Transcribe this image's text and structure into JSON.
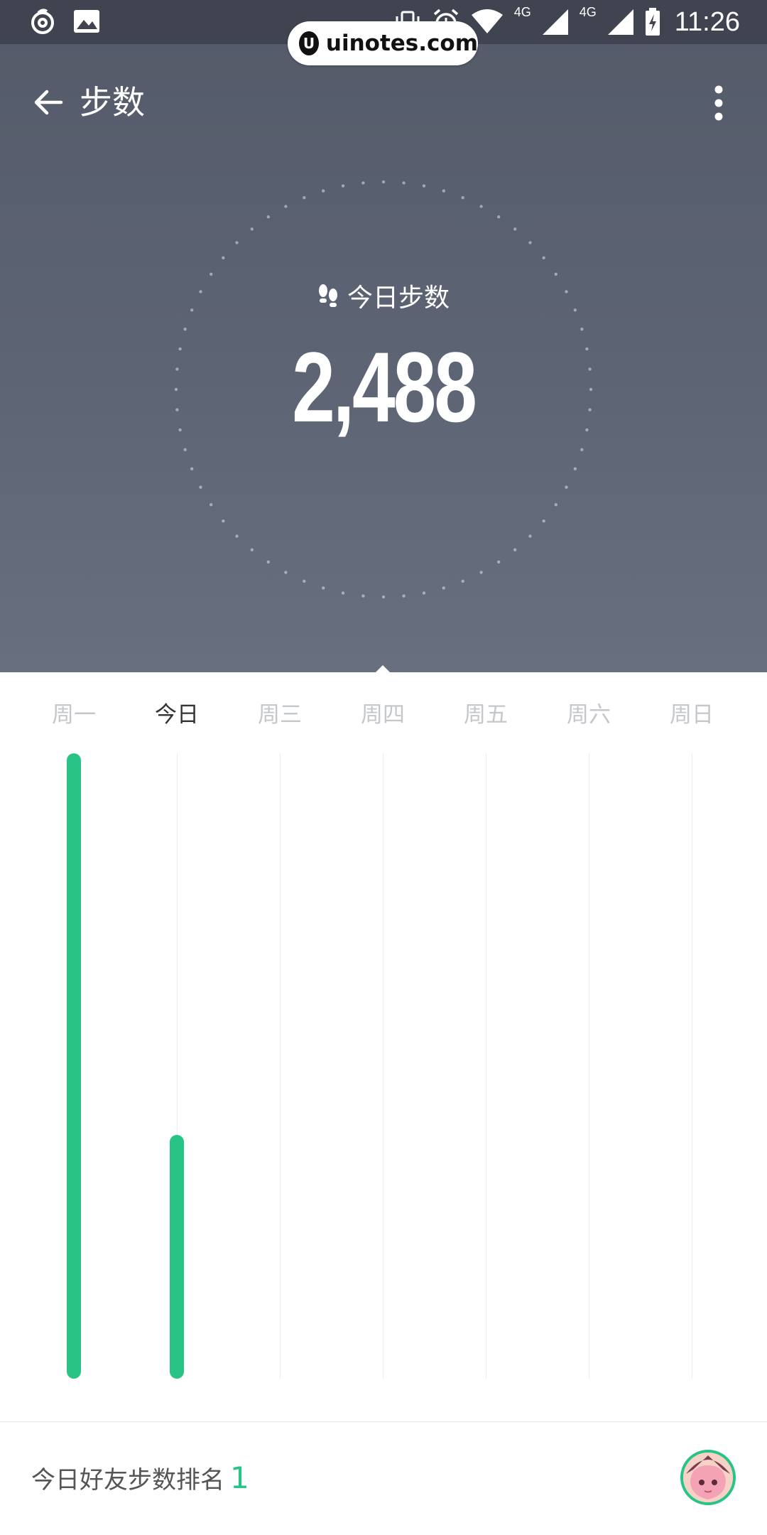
{
  "status_bar": {
    "time": "11:26",
    "network_1": "4G",
    "network_2": "4G"
  },
  "watermark": {
    "text": "uinotes.com"
  },
  "header": {
    "title": "步数"
  },
  "today": {
    "label": "今日步数",
    "steps": "2,488"
  },
  "days": [
    {
      "label": "周一",
      "active": false
    },
    {
      "label": "今日",
      "active": true
    },
    {
      "label": "周三",
      "active": false
    },
    {
      "label": "周四",
      "active": false
    },
    {
      "label": "周五",
      "active": false
    },
    {
      "label": "周六",
      "active": false
    },
    {
      "label": "周日",
      "active": false
    }
  ],
  "chart_data": {
    "type": "bar",
    "categories": [
      "周一",
      "今日",
      "周三",
      "周四",
      "周五",
      "周六",
      "周日"
    ],
    "values": [
      1.0,
      0.39,
      0,
      0,
      0,
      0,
      0
    ],
    "ylim": [
      0,
      1
    ]
  },
  "ranking": {
    "label": "今日好友步数排名",
    "rank": "1"
  },
  "colors": {
    "accent": "#27c485",
    "hero_top": "#545a68",
    "hero_bottom": "#68707f"
  }
}
